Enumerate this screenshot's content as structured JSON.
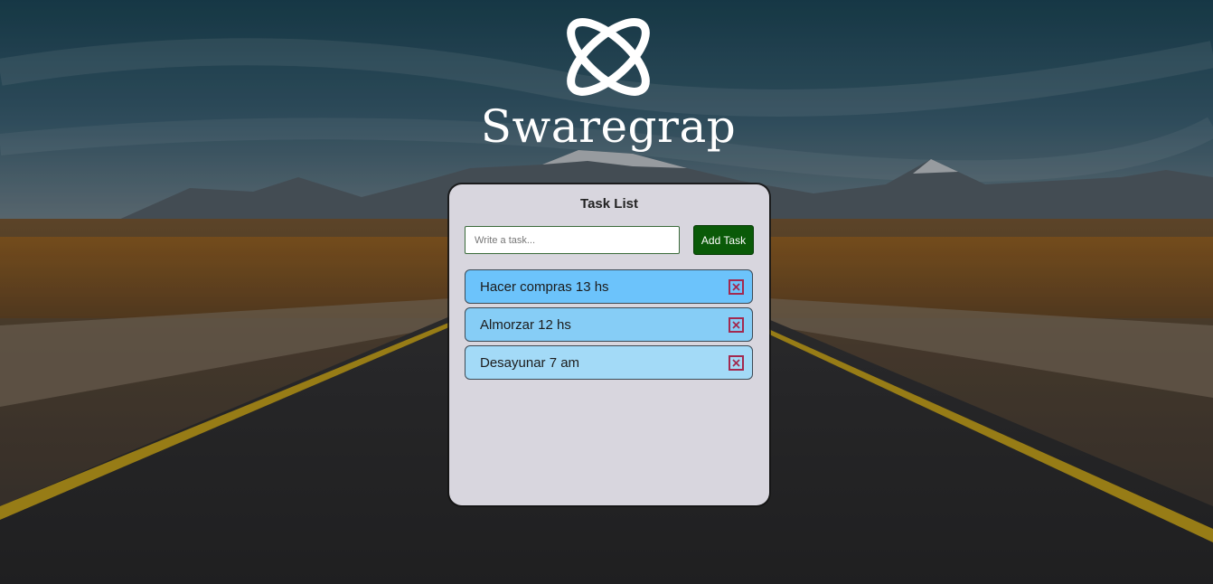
{
  "brand": {
    "name": "Swaregrap"
  },
  "card": {
    "title": "Task List"
  },
  "form": {
    "input_value": "",
    "input_placeholder": "Write a task...",
    "add_label": "Add Task"
  },
  "tasks": [
    {
      "label": "Hacer compras 13 hs",
      "color": "#6cc3fb"
    },
    {
      "label": "Almorzar 12 hs",
      "color": "#86cdf6"
    },
    {
      "label": "Desayunar 7 am",
      "color": "#a3daf7"
    }
  ],
  "colors": {
    "card_background": "#d8d6de",
    "add_button": "#0a5a08",
    "delete_icon": "#a3294f"
  },
  "icons": {
    "logo": "orbit-logo-icon",
    "delete": "close-icon"
  }
}
